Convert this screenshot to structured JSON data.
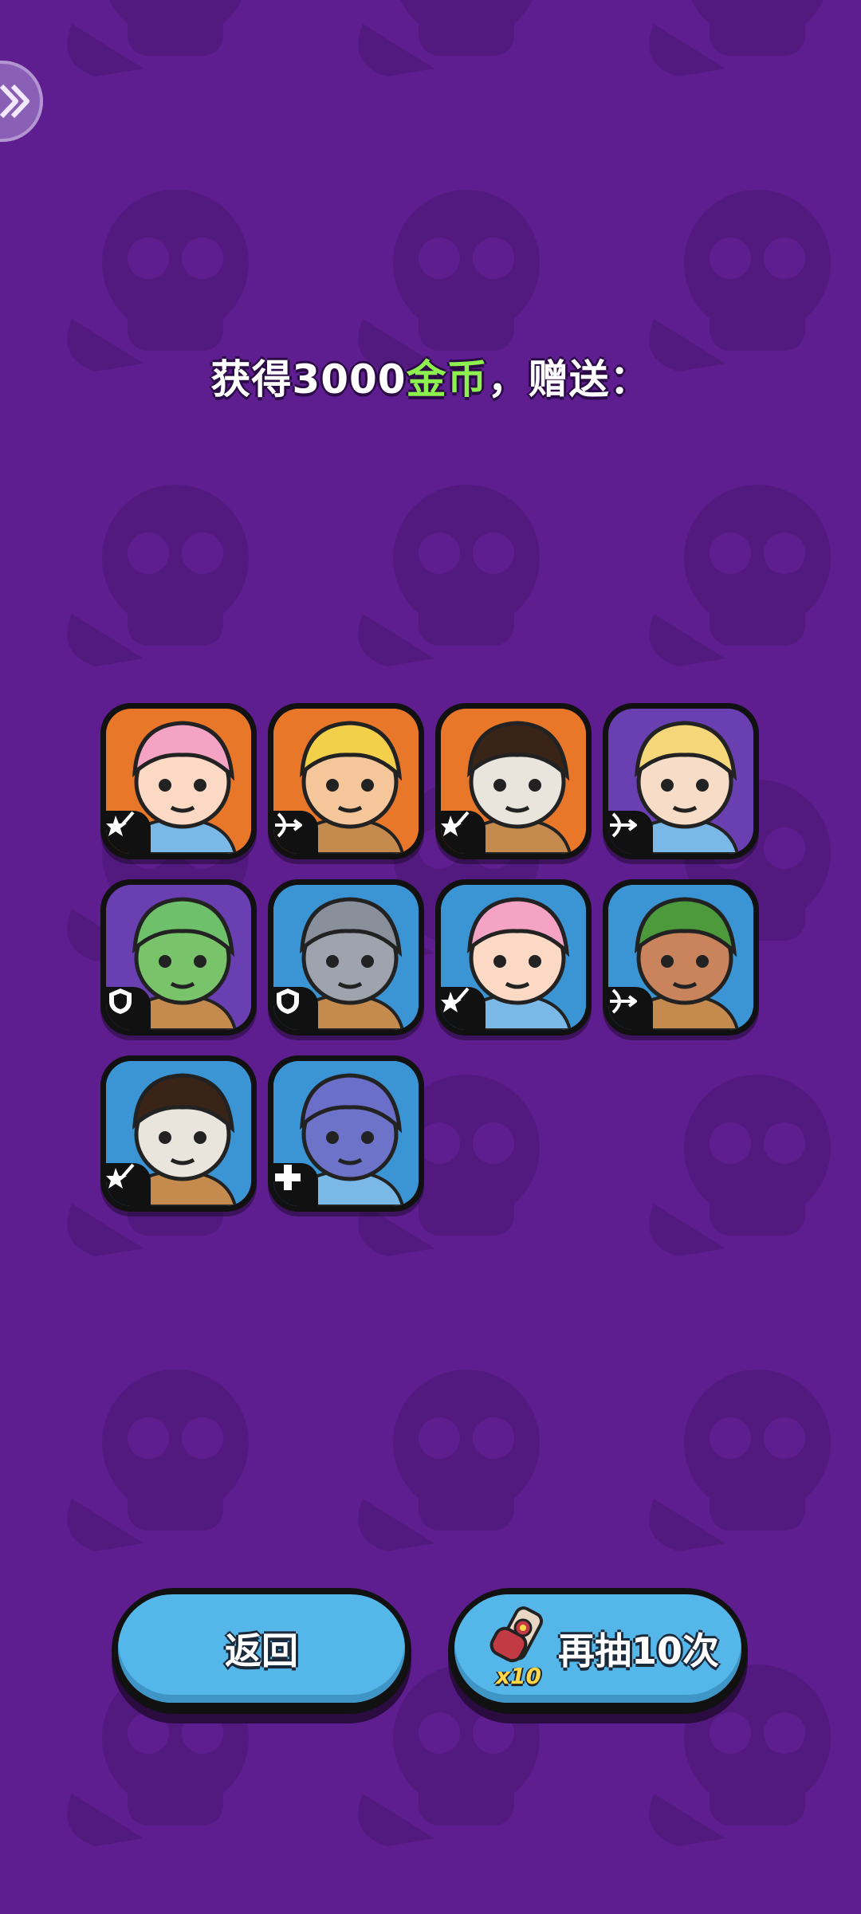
{
  "title": {
    "prefix": "获得3000",
    "highlight": "金币",
    "suffix": "，赠送："
  },
  "heroes": [
    {
      "name": "pink-haired-spear-girl",
      "bg": "#e8772a",
      "class_icon": "star-sword-icon"
    },
    {
      "name": "blonde-bandana-archer",
      "bg": "#e8772a",
      "class_icon": "bow-icon"
    },
    {
      "name": "skull-mask-girl",
      "bg": "#e8772a",
      "class_icon": "star-sword-icon"
    },
    {
      "name": "blonde-zombie-archer",
      "bg": "#6a3fb1",
      "class_icon": "bow-icon"
    },
    {
      "name": "frog-king-tank",
      "bg": "#6a3fb1",
      "class_icon": "shield-icon"
    },
    {
      "name": "armored-knight-tank",
      "bg": "#3b94d3",
      "class_icon": "shield-icon"
    },
    {
      "name": "pink-haired-spear-girl",
      "bg": "#3b94d3",
      "class_icon": "star-sword-icon"
    },
    {
      "name": "green-hooded-archer",
      "bg": "#3b94d3",
      "class_icon": "bow-icon"
    },
    {
      "name": "skull-mask-girl",
      "bg": "#3b94d3",
      "class_icon": "star-sword-icon"
    },
    {
      "name": "blue-ogre-healer",
      "bg": "#3b94d3",
      "class_icon": "plus-icon"
    }
  ],
  "buttons": {
    "back_label": "返回",
    "redraw_label": "再抽10次",
    "redraw_count": "x10"
  },
  "colors": {
    "background": "#5e1e8f",
    "highlight_text": "#8ef04f",
    "button": "#55b6ea"
  }
}
